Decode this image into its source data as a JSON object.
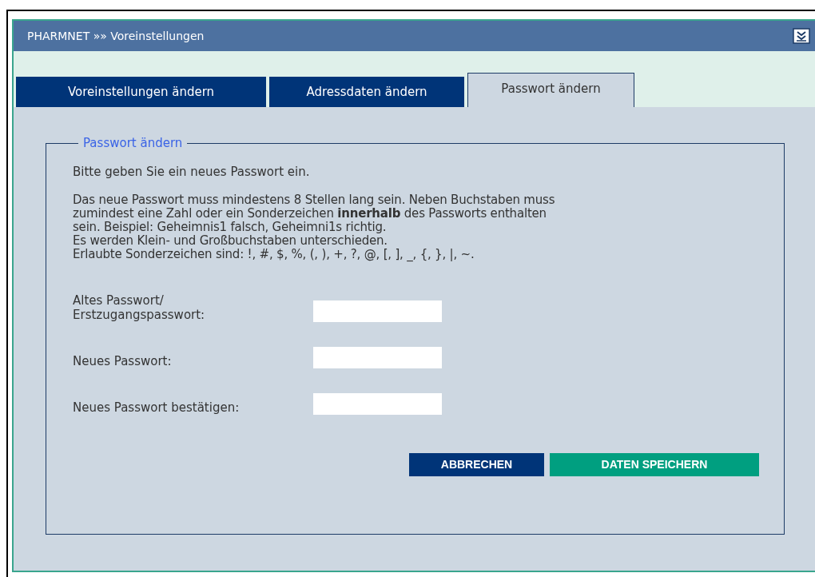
{
  "window": {
    "title": "PHARMNET »» Voreinstellungen"
  },
  "tabs": [
    {
      "label": "Voreinstellungen ändern",
      "selected": false
    },
    {
      "label": "Adressdaten ändern",
      "selected": false
    },
    {
      "label": "Passwort ändern",
      "selected": true
    }
  ],
  "section": {
    "legend": "Passwort ändern",
    "intro": "Bitte geben Sie ein neues Passwort ein.",
    "rules": [
      "Das neue Passwort muss mindestens 8 Stellen lang sein. Neben Buchstaben muss",
      "zumindest eine Zahl oder ein Sonderzeichen **innerhalb** des Passworts enthalten",
      "sein. Beispiel: Geheimnis1 falsch, Geheimni1s richtig.",
      "Es werden Klein- und Großbuchstaben unterschieden.",
      "Erlaubte Sonderzeichen sind: !, #, $, %, (, ), +, ?, @, [, ], _, {, }, |, ~."
    ],
    "fields": [
      {
        "label": "Altes Passwort/\nErstzugangspasswort:"
      },
      {
        "label": "Neues Passwort:"
      },
      {
        "label": "Neues Passwort bestätigen:"
      }
    ],
    "buttons": [
      {
        "label": "ABBRECHEN",
        "kind": "cancel"
      },
      {
        "label": "DATEN SPEICHERN",
        "kind": "save"
      }
    ]
  }
}
